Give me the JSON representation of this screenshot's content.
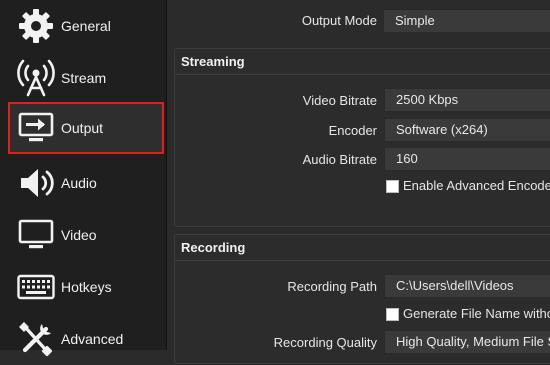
{
  "sidebar": {
    "items": [
      {
        "label": "General",
        "icon": "gear-icon"
      },
      {
        "label": "Stream",
        "icon": "broadcast-tower-icon"
      },
      {
        "label": "Output",
        "icon": "output-monitor-icon",
        "active": true
      },
      {
        "label": "Audio",
        "icon": "speaker-icon"
      },
      {
        "label": "Video",
        "icon": "monitor-icon"
      },
      {
        "label": "Hotkeys",
        "icon": "keyboard-icon"
      },
      {
        "label": "Advanced",
        "icon": "wrench-screwdriver-icon"
      }
    ],
    "highlight_color": "#e0201f"
  },
  "output_mode": {
    "label": "Output Mode",
    "value": "Simple"
  },
  "streaming": {
    "title": "Streaming",
    "video_bitrate_label": "Video Bitrate",
    "video_bitrate_value": "2500 Kbps",
    "encoder_label": "Encoder",
    "encoder_value": "Software (x264)",
    "audio_bitrate_label": "Audio Bitrate",
    "audio_bitrate_value": "160",
    "advanced_encoder_label": "Enable Advanced Encoder S",
    "advanced_encoder_checked": false
  },
  "recording": {
    "title": "Recording",
    "path_label": "Recording Path",
    "path_value": "C:\\Users\\dell\\Videos",
    "generate_filename_label": "Generate File Name without",
    "generate_filename_checked": false,
    "quality_label": "Recording Quality",
    "quality_value": "High Quality, Medium File Size"
  }
}
